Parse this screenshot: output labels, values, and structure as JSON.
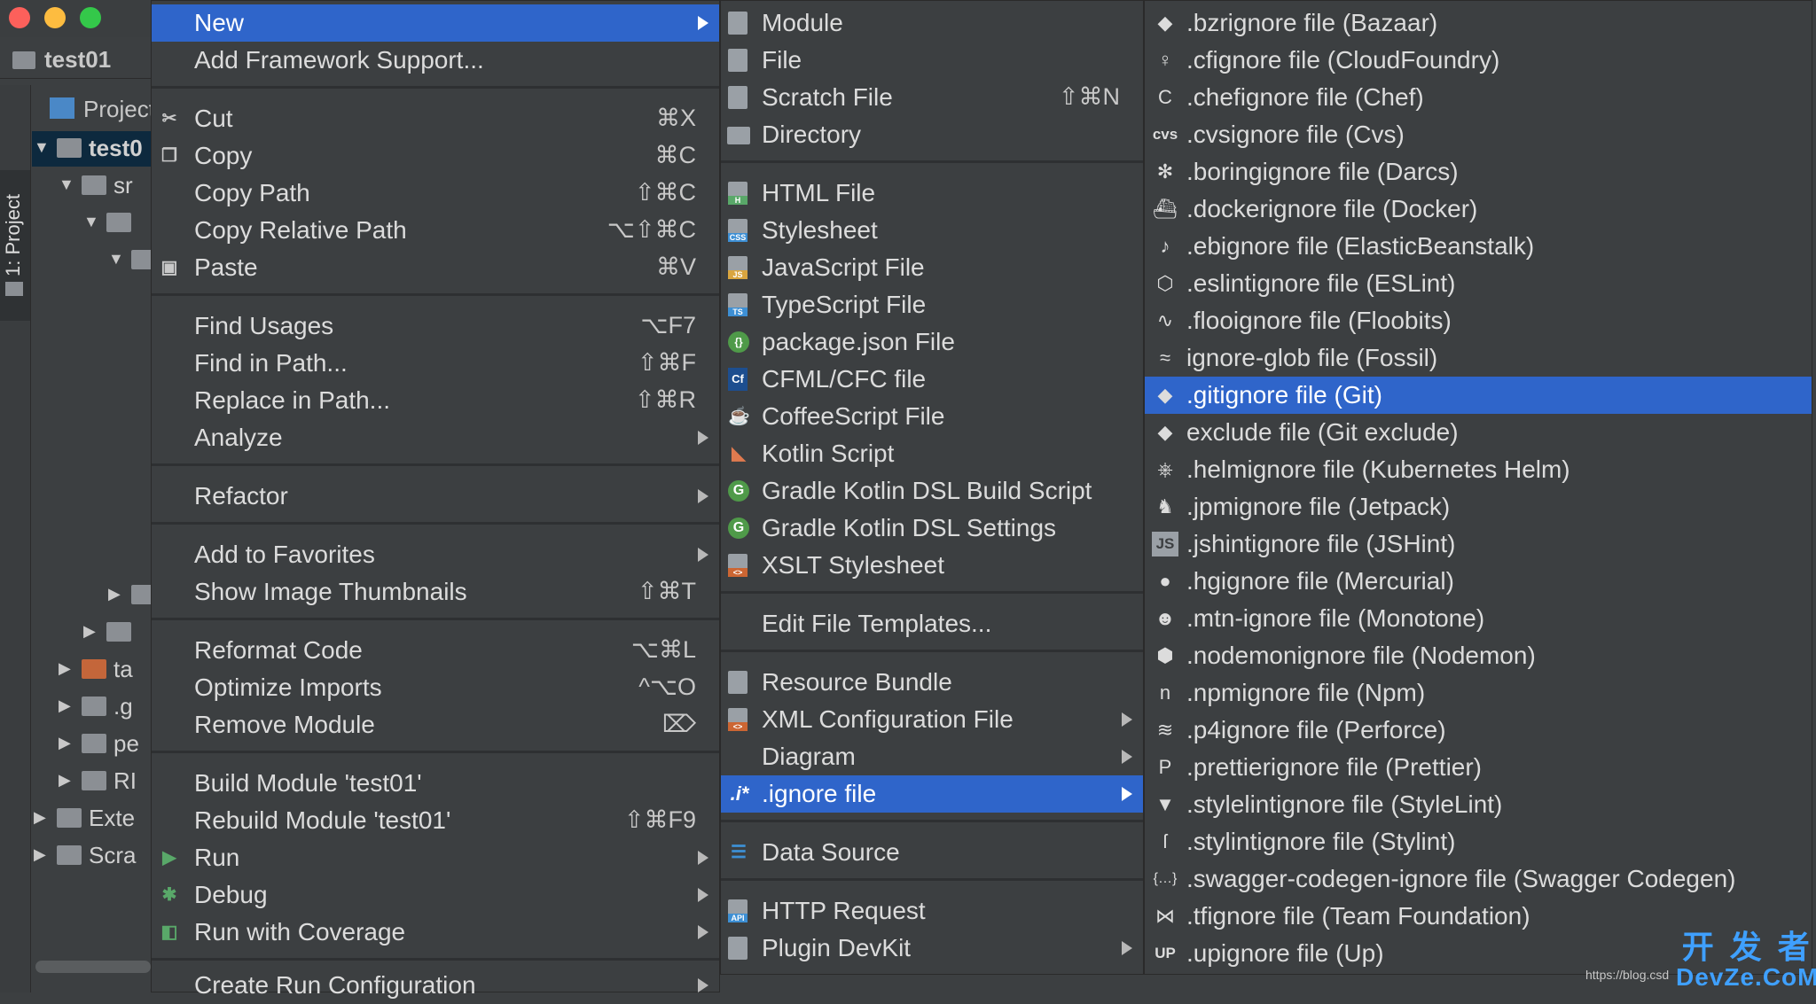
{
  "window": {
    "breadcrumb": "test01",
    "traffic_colors": [
      "#fc605b",
      "#fdbc40",
      "#34c84a"
    ]
  },
  "sidebar": {
    "tab_label": "1: Project"
  },
  "project_tree": {
    "header": "Project",
    "rows": [
      {
        "label": "test0",
        "expanded": true
      },
      {
        "label": "sr",
        "expanded": true
      },
      {
        "label": "",
        "expanded": true
      },
      {
        "label": "",
        "expanded": true
      },
      {
        "label": "",
        "expanded": false
      },
      {
        "label": "",
        "expanded": false
      },
      {
        "label": "ta",
        "expanded": false
      },
      {
        "label": ".g",
        "expanded": false
      },
      {
        "label": "pe",
        "expanded": false
      },
      {
        "label": "RI",
        "expanded": false
      },
      {
        "label": "Exte",
        "expanded": false
      },
      {
        "label": "Scra",
        "expanded": false
      }
    ]
  },
  "main_menu": {
    "items": [
      {
        "label": "New",
        "selected": true,
        "submenu": true
      },
      {
        "label": "Add Framework Support..."
      },
      {
        "label": "Cut",
        "shortcut": "⌘X",
        "icon": "scissors-icon"
      },
      {
        "label": "Copy",
        "shortcut": "⌘C",
        "icon": "copy-icon"
      },
      {
        "label": "Copy Path",
        "shortcut": "⇧⌘C"
      },
      {
        "label": "Copy Relative Path",
        "shortcut": "⌥⇧⌘C"
      },
      {
        "label": "Paste",
        "shortcut": "⌘V",
        "icon": "clipboard-icon"
      },
      {
        "label": "Find Usages",
        "shortcut": "⌥F7"
      },
      {
        "label": "Find in Path...",
        "shortcut": "⇧⌘F"
      },
      {
        "label": "Replace in Path...",
        "shortcut": "⇧⌘R"
      },
      {
        "label": "Analyze",
        "submenu": true
      },
      {
        "label": "Refactor",
        "submenu": true
      },
      {
        "label": "Add to Favorites",
        "submenu": true
      },
      {
        "label": "Show Image Thumbnails",
        "shortcut": "⇧⌘T"
      },
      {
        "label": "Reformat Code",
        "shortcut": "⌥⌘L"
      },
      {
        "label": "Optimize Imports",
        "shortcut": "^⌥O"
      },
      {
        "label": "Remove Module",
        "shortcut": "⌦"
      },
      {
        "label": "Build Module 'test01'"
      },
      {
        "label": "Rebuild Module 'test01'",
        "shortcut": "⇧⌘F9"
      },
      {
        "label": "Run",
        "submenu": true,
        "icon": "run-icon"
      },
      {
        "label": "Debug",
        "submenu": true,
        "icon": "debug-icon"
      },
      {
        "label": "Run with Coverage",
        "submenu": true,
        "icon": "coverage-icon"
      },
      {
        "label": "Create Run Configuration",
        "submenu": true
      }
    ]
  },
  "new_menu": {
    "items": [
      {
        "label": "Module",
        "icon_text": ""
      },
      {
        "label": "File",
        "icon_text": ""
      },
      {
        "label": "Scratch File",
        "shortcut": "⇧⌘N",
        "icon_text": ""
      },
      {
        "label": "Directory",
        "icon_text": ""
      },
      {
        "label": "HTML File",
        "icon_text": "H"
      },
      {
        "label": "Stylesheet",
        "icon_text": "CSS"
      },
      {
        "label": "JavaScript File",
        "icon_text": "JS"
      },
      {
        "label": "TypeScript File",
        "icon_text": "TS"
      },
      {
        "label": "package.json File",
        "icon_text": ""
      },
      {
        "label": "CFML/CFC file",
        "icon_text": "Cf"
      },
      {
        "label": "CoffeeScript File",
        "icon_text": ""
      },
      {
        "label": "Kotlin Script",
        "icon_text": ""
      },
      {
        "label": "Gradle Kotlin DSL Build Script",
        "icon_text": "G"
      },
      {
        "label": "Gradle Kotlin DSL Settings",
        "icon_text": "G"
      },
      {
        "label": "XSLT Stylesheet",
        "icon_text": "<>"
      },
      {
        "label": "Edit File Templates..."
      },
      {
        "label": "Resource Bundle",
        "icon_text": ""
      },
      {
        "label": "XML Configuration File",
        "submenu": true,
        "icon_text": "<>"
      },
      {
        "label": "Diagram",
        "submenu": true
      },
      {
        "label": ".ignore file",
        "submenu": true,
        "selected": true,
        "icon_text": ".i*"
      },
      {
        "label": "Data Source",
        "icon_text": ""
      },
      {
        "label": "HTTP Request",
        "icon_text": "API"
      },
      {
        "label": "Plugin DevKit",
        "submenu": true,
        "icon_text": ""
      }
    ]
  },
  "ignore_menu": {
    "items": [
      {
        "label": ".bzrignore file (Bazaar)",
        "icon_text": "◆"
      },
      {
        "label": ".cfignore file (CloudFoundry)",
        "icon_text": "♀"
      },
      {
        "label": ".chefignore file (Chef)",
        "icon_text": "C"
      },
      {
        "label": ".cvsignore file (Cvs)",
        "icon_text": "cvs"
      },
      {
        "label": ".boringignore file (Darcs)",
        "icon_text": "✻"
      },
      {
        "label": ".dockerignore file (Docker)",
        "icon_text": "⛴"
      },
      {
        "label": ".ebignore file (ElasticBeanstalk)",
        "icon_text": "♪"
      },
      {
        "label": ".eslintignore file (ESLint)",
        "icon_text": "⬡"
      },
      {
        "label": ".flooignore file (Floobits)",
        "icon_text": "∿"
      },
      {
        "label": "ignore-glob file (Fossil)",
        "icon_text": "≈"
      },
      {
        "label": ".gitignore file (Git)",
        "icon_text": "◆",
        "selected": true
      },
      {
        "label": "exclude file (Git exclude)",
        "icon_text": "◆"
      },
      {
        "label": ".helmignore file (Kubernetes Helm)",
        "icon_text": "⎈"
      },
      {
        "label": ".jpmignore file (Jetpack)",
        "icon_text": "♞"
      },
      {
        "label": ".jshintignore file (JSHint)",
        "icon_text": "JS"
      },
      {
        "label": ".hgignore file (Mercurial)",
        "icon_text": "●"
      },
      {
        "label": ".mtn-ignore file (Monotone)",
        "icon_text": "☻"
      },
      {
        "label": ".nodemonignore file (Nodemon)",
        "icon_text": "⬢"
      },
      {
        "label": ".npmignore file (Npm)",
        "icon_text": "n"
      },
      {
        "label": ".p4ignore file (Perforce)",
        "icon_text": "≋"
      },
      {
        "label": ".prettierignore file (Prettier)",
        "icon_text": "P"
      },
      {
        "label": ".stylelintignore file (StyleLint)",
        "icon_text": "▼"
      },
      {
        "label": ".stylintignore file (Stylint)",
        "icon_text": "ſ"
      },
      {
        "label": ".swagger-codegen-ignore file (Swagger Codegen)",
        "icon_text": "{…}"
      },
      {
        "label": ".tfignore file (Team Foundation)",
        "icon_text": "⋈"
      },
      {
        "label": ".upignore file (Up)",
        "icon_text": "UP"
      }
    ]
  },
  "watermark": {
    "url": "https://blog.csd",
    "brand_cn": "开 发 者",
    "brand": "DevZe.CoM"
  },
  "colors": {
    "selection": "#2f65ca",
    "menu_bg": "#3c3f41",
    "text": "#dcdcdc"
  }
}
